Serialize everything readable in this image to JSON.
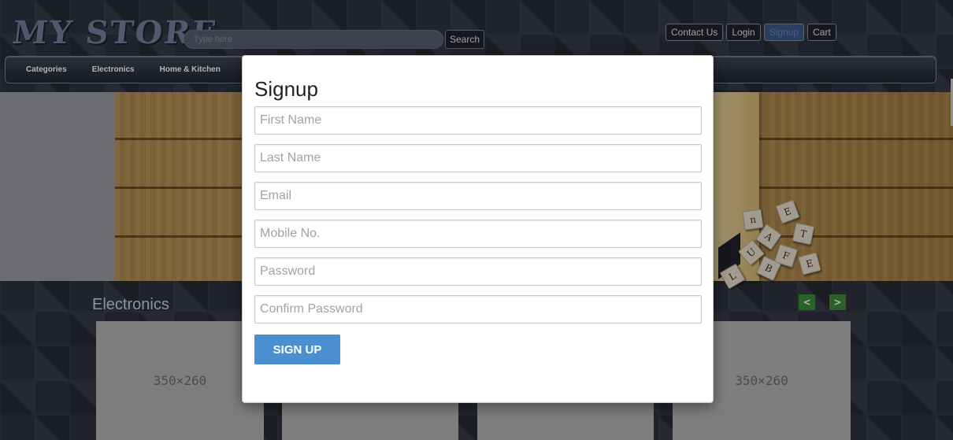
{
  "header": {
    "logo": "MY STORE",
    "search_placeholder": "Type here",
    "search_label": "Search",
    "nav": [
      "Contact Us",
      "Login",
      "Signup",
      "Cart"
    ]
  },
  "categories": [
    "Categories",
    "Electronics",
    "Home & Kitchen"
  ],
  "banner": {
    "tiles": [
      "n",
      "E",
      "A",
      "T",
      "U",
      "F",
      "E",
      "B",
      "L"
    ]
  },
  "section": {
    "title": "Electronics",
    "prev_icon": "chevron-left-icon",
    "prev_glyph": "<",
    "next_icon": "chevron-right-icon",
    "next_glyph": ">",
    "products": [
      "350×260",
      "",
      "",
      "350×260"
    ]
  },
  "modal": {
    "title": "Signup",
    "fields": [
      {
        "placeholder": "First Name",
        "type": "text"
      },
      {
        "placeholder": "Last Name",
        "type": "text"
      },
      {
        "placeholder": "Email",
        "type": "email"
      },
      {
        "placeholder": "Mobile No.",
        "type": "tel"
      },
      {
        "placeholder": "Password",
        "type": "password"
      },
      {
        "placeholder": "Confirm Password",
        "type": "password"
      }
    ],
    "button_label": "SIGN UP"
  },
  "colors": {
    "accent": "#4a90d0",
    "active_nav": "#3d5a8c",
    "carousel_arrow": "#3c8c3c"
  }
}
